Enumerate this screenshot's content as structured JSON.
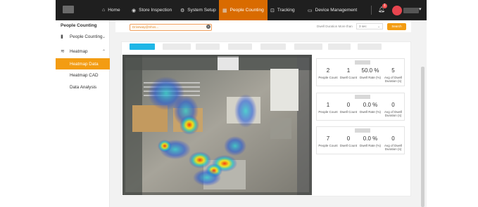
{
  "nav": {
    "home": "Home",
    "store_inspection": "Store Inspection",
    "system_setup": "System Setup",
    "people_counting": "People Counting",
    "tracking": "Tracking",
    "device_management": "Device Management",
    "notification_count": "1"
  },
  "sidebar": {
    "title": "People Counting",
    "items": [
      {
        "label": "People Counting",
        "icon": "bar-chart-icon"
      },
      {
        "label": "Heatmap",
        "icon": "heatmap-icon"
      },
      {
        "label": "Heatmap Data",
        "active": true
      },
      {
        "label": "Heatmap CAD"
      },
      {
        "label": "Data Analysis"
      }
    ]
  },
  "toolbar": {
    "filter_value": "Driveway@Shos...",
    "dwell_label": "Dwell Duration  More than",
    "dwell_value": "3 sec",
    "search_label": "Search"
  },
  "stats": {
    "labels": [
      "People Count",
      "Dwell Count",
      "Dwell Rate (%)",
      "Avg of Dwell Duration (s)"
    ],
    "panels": [
      {
        "people": "2",
        "dwell": "1",
        "rate": "50.0 %",
        "avg": "5"
      },
      {
        "people": "1",
        "dwell": "0",
        "rate": "0.0 %",
        "avg": "0"
      },
      {
        "people": "7",
        "dwell": "0",
        "rate": "0.0 %",
        "avg": "0"
      }
    ]
  },
  "colors": {
    "accent": "#f39c12",
    "active_nav": "#d96b00",
    "topbar": "#1f1f1f",
    "tab_active": "#1fb6e6"
  }
}
